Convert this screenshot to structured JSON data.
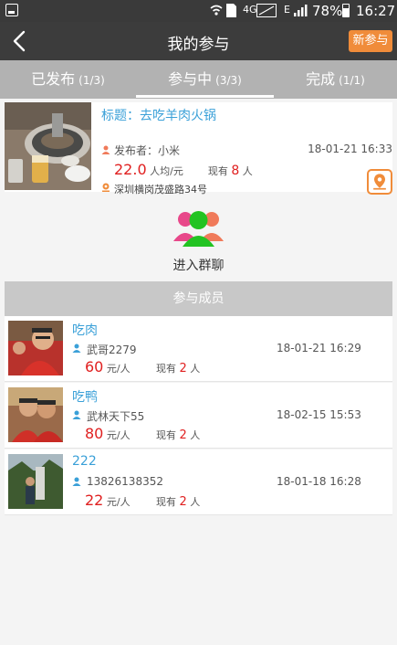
{
  "status_bar": {
    "network": "4G",
    "carrier": "E",
    "battery": "78%",
    "time": "16:27"
  },
  "header": {
    "title": "我的参与",
    "new_button": "新参与"
  },
  "tabs": [
    {
      "label": "已发布",
      "count": "(1/3)"
    },
    {
      "label": "参与中",
      "count": "(3/3)"
    },
    {
      "label": "完成",
      "count": "(1/1)"
    }
  ],
  "event": {
    "title": "标题：去吃羊肉火锅",
    "publisher": "发布者：小米",
    "date": "18-01-21 16:33",
    "price": "22.0",
    "price_unit": "人均/元",
    "current_prefix": "现有",
    "current_count": "8",
    "current_suffix": "人",
    "address": "深圳横岗茂盛路34号"
  },
  "group_chat": {
    "label": "进入群聊"
  },
  "members_section": {
    "title": "参与成员"
  },
  "members": [
    {
      "name": "吃肉",
      "user": "武哥2279",
      "date": "18-01-21 16:29",
      "price": "60",
      "price_unit": "元/人",
      "current_prefix": "现有",
      "current_count": "2",
      "current_suffix": "人"
    },
    {
      "name": "吃鸭",
      "user": "武林天下55",
      "date": "18-02-15 15:53",
      "price": "80",
      "price_unit": "元/人",
      "current_prefix": "现有",
      "current_count": "2",
      "current_suffix": "人"
    },
    {
      "name": "222",
      "user": "13826138352",
      "date": "18-01-18 16:28",
      "price": "22",
      "price_unit": "元/人",
      "current_prefix": "现有",
      "current_count": "2",
      "current_suffix": "人"
    }
  ],
  "colors": {
    "accent_orange": "#f08c3a",
    "link_blue": "#3aa0d8",
    "price_red": "#e02020"
  }
}
